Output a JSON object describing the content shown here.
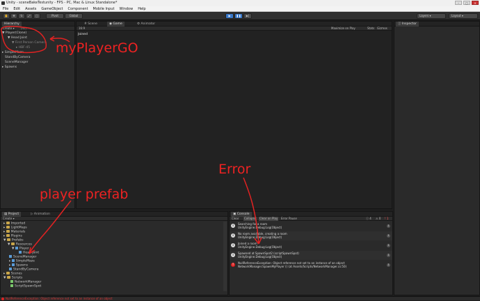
{
  "window": {
    "title": "Unity - sceneBakeTestunity - FPS - PC, Mac & Linux Standalone*"
  },
  "menu": {
    "items": [
      "File",
      "Edit",
      "Assets",
      "GameObject",
      "Component",
      "Mobile Input",
      "Window",
      "Help"
    ]
  },
  "toolbar": {
    "pivot": "Pivot",
    "global": "Global",
    "layers": "Layers",
    "layout": "Layout"
  },
  "hierarchy": {
    "tab": "Hierarchy",
    "create": "Create",
    "search": "(All)",
    "rows": [
      "Player(Clone)",
      "Head Joint",
      "First Person Camera",
      "HBF-45",
      "SimpleMaze",
      "StandByCamera",
      "SceneManager",
      "Spawns"
    ]
  },
  "scene_tabs": {
    "scene": "Scene",
    "game": "Game",
    "animator": "Animator",
    "aspect": "16:9",
    "maximize": "Maximize on Play",
    "stats": "Stats",
    "gizmos": "Gizmos"
  },
  "game": {
    "text": "Joined"
  },
  "inspector": {
    "tab": "Inspector"
  },
  "project": {
    "tab": "Project",
    "animation": "Animation",
    "create": "Create",
    "rows": [
      "Imported",
      "LightMaps",
      "Materials",
      "Plugins",
      "Prefabs",
      "Resources",
      "Player",
      "Head Joint",
      "SceneManager",
      "SimpleMaze",
      "Spawns",
      "StandByCamera",
      "Scenes",
      "Scripts",
      "NetworkManager",
      "ScriptSpawnSpot"
    ]
  },
  "console": {
    "tab": "Console",
    "buttons": [
      "Clear",
      "Collapse",
      "Clear on Play",
      "Error Pause"
    ],
    "logs": [
      {
        "line1": "Searching for a room",
        "line2": "UnityEngine.Debug:Log(Object)",
        "count": "1",
        "type": "info"
      },
      {
        "line1": "No room available, creating a room",
        "line2": "UnityEngine.Debug:Log(Object)",
        "count": "1",
        "type": "info"
      },
      {
        "line1": "Joined a room",
        "line2": "UnityEngine.Debug:Log(Object)",
        "count": "1",
        "type": "info"
      },
      {
        "line1": "Spawned at SpawnSpot2 (scriptSpawnSpot)",
        "line2": "UnityEngine.Debug:Log(Object)",
        "count": "1",
        "type": "info"
      },
      {
        "line1": "NullReferenceException: Object reference not set to an instance of an object",
        "line2": "NetworkManager.SpawnMyPlayer () (at Assets/Scripts/NetworkManager.cs:50)",
        "count": "1",
        "type": "error"
      }
    ],
    "counts": {
      "info": "4",
      "warn": "0",
      "error": "1"
    }
  },
  "status": {
    "text": "NullReferenceException: Object reference not set to an instance of an object"
  },
  "annotations": {
    "player_go": "myPlayerGO",
    "error": "Error",
    "prefab": "player prefab"
  },
  "colors": {
    "annotation": "#e22222",
    "selection": "#3a78c8",
    "folder": "#c9a64a"
  }
}
